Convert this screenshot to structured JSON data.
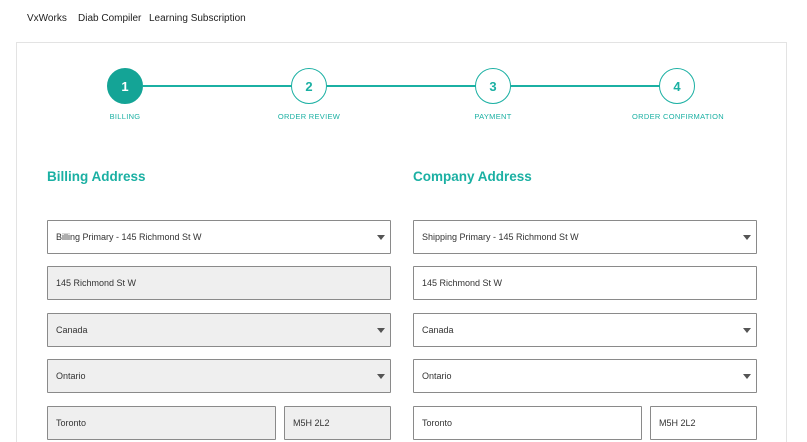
{
  "topnav": {
    "links": [
      "VxWorks",
      "Diab Compiler",
      "Learning Subscription"
    ]
  },
  "stepper": {
    "steps": [
      {
        "number": "1",
        "label": "BILLING",
        "active": true
      },
      {
        "number": "2",
        "label": "ORDER REVIEW",
        "active": false
      },
      {
        "number": "3",
        "label": "PAYMENT",
        "active": false
      },
      {
        "number": "4",
        "label": "ORDER CONFIRMATION",
        "active": false
      }
    ]
  },
  "billing": {
    "title": "Billing Address",
    "address_select": "Billing Primary - 145 Richmond St W",
    "street": "145 Richmond St W",
    "country": "Canada",
    "province": "Ontario",
    "city": "Toronto",
    "postal_code": "M5H 2L2"
  },
  "company": {
    "title": "Company Address",
    "address_select": "Shipping Primary - 145 Richmond St W",
    "street": "145 Richmond St W",
    "country": "Canada",
    "province": "Ontario",
    "city": "Toronto",
    "postal_code": "M5H 2L2"
  },
  "colors": {
    "accent": "#1bb0a3",
    "accent_active": "#14a496",
    "disabled_field": "#efefef"
  },
  "icons": {
    "dropdown": "caret-down-icon"
  }
}
